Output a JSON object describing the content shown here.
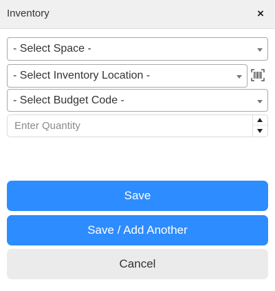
{
  "dialog": {
    "title": "Inventory",
    "close_symbol": "×"
  },
  "form": {
    "space_select": {
      "selected": "- Select Space -"
    },
    "location_select": {
      "selected": "- Select Inventory Location -"
    },
    "barcode_icon": "barcode-icon",
    "budget_select": {
      "selected": "- Select Budget Code -"
    },
    "quantity": {
      "value": "",
      "placeholder": "Enter Quantity"
    }
  },
  "actions": {
    "save_label": "Save",
    "save_add_label": "Save / Add Another",
    "cancel_label": "Cancel"
  },
  "colors": {
    "primary": "#2d8cff",
    "secondary": "#ebebeb",
    "header_bg": "#f0f0f0"
  }
}
